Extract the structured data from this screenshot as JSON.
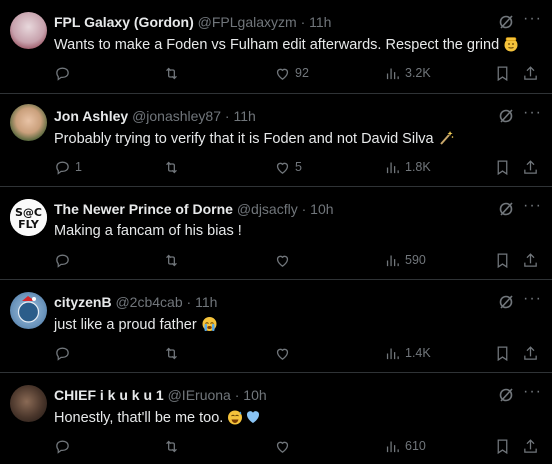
{
  "tweets": [
    {
      "name": "FPL Galaxy (Gordon)",
      "handle": "@FPLgalaxyzm",
      "time": "· 11h",
      "text": "Wants to make a Foden vs Fulham edit afterwards. Respect the grind",
      "emoji": "saluting-face",
      "reply_count": "",
      "retweet_count": "",
      "like_count": "92",
      "view_count": "3.2K"
    },
    {
      "name": "Jon Ashley",
      "handle": "@jonashley87",
      "time": "· 11h",
      "text": "Probably trying to verify that it is Foden and not David Silva",
      "emoji": "magic-wand",
      "reply_count": "1",
      "retweet_count": "",
      "like_count": "5",
      "view_count": "1.8K"
    },
    {
      "name": "The Newer Prince of Dorne",
      "handle": "@djsacfly",
      "time": "· 10h",
      "text": "Making a fancam of his bias !",
      "emoji": "",
      "reply_count": "",
      "retweet_count": "",
      "like_count": "",
      "view_count": "590",
      "avatar_text": "S@C\nFLY"
    },
    {
      "name": "cityzenB",
      "handle": "@2cb4cab",
      "time": "· 11h",
      "text": "just like a proud father",
      "emoji": "crying-face",
      "reply_count": "",
      "retweet_count": "",
      "like_count": "",
      "view_count": "1.4K"
    },
    {
      "name": "CHIEF i k u k u 1",
      "handle": "@IEruona",
      "time": "· 10h",
      "text": "Honestly, that'll be me too.",
      "emoji": "sweat-smile-blue-heart",
      "reply_count": "",
      "retweet_count": "",
      "like_count": "",
      "view_count": "610"
    }
  ],
  "colors": {
    "background": "#000000",
    "text": "#e7e9ea",
    "muted": "#71767b",
    "divider": "#2f3336"
  }
}
